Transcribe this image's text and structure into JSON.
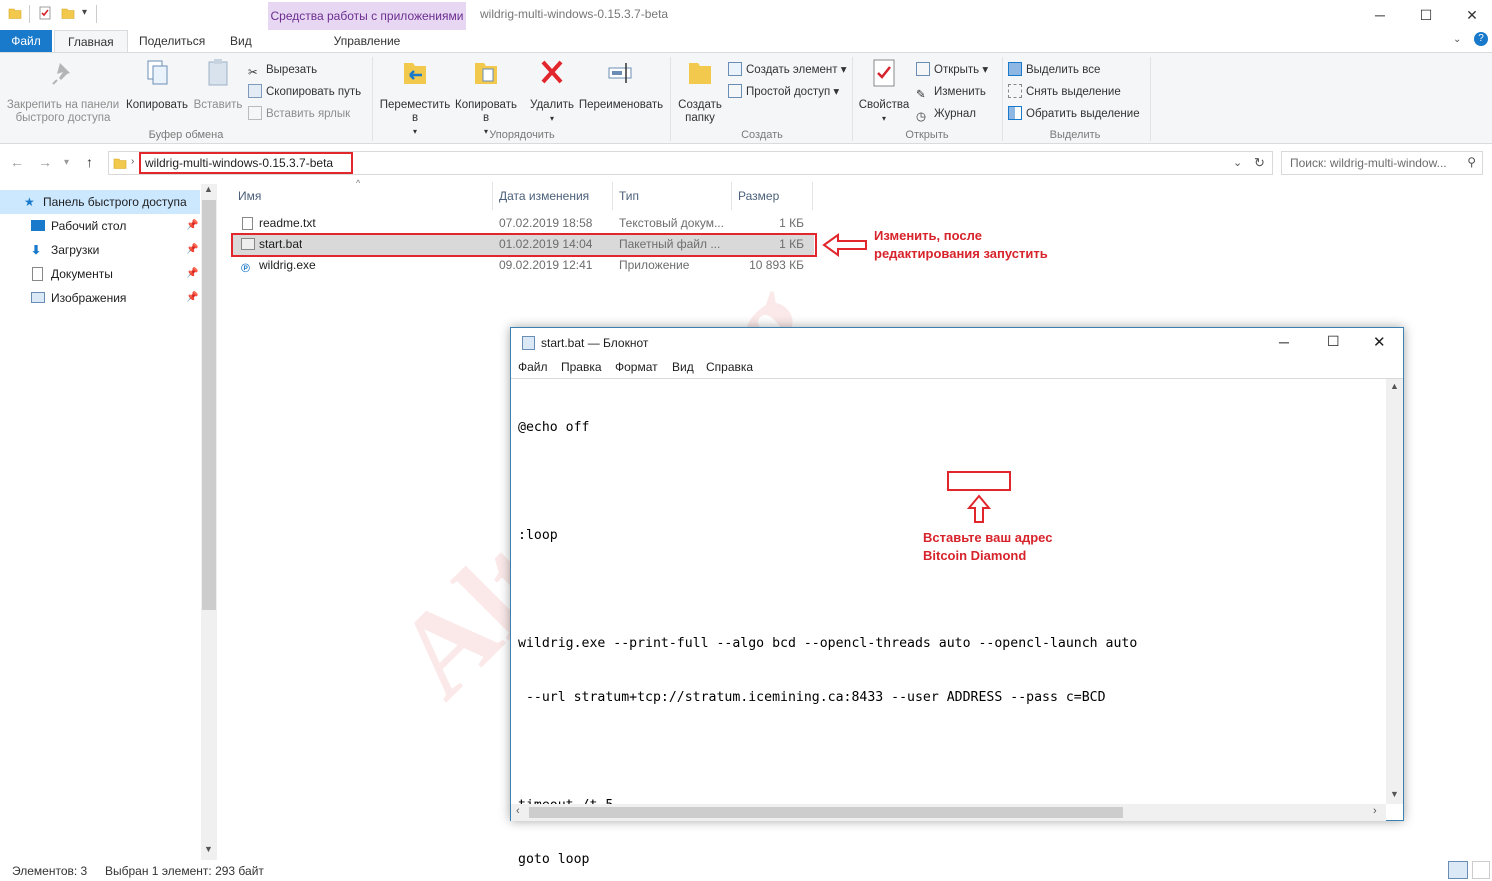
{
  "window": {
    "title": "wildrig-multi-windows-0.15.3.7-beta",
    "context_group": "Средства работы с приложениями"
  },
  "tabs": {
    "file": "Файл",
    "home": "Главная",
    "share": "Поделиться",
    "view": "Вид",
    "manage": "Управление"
  },
  "ribbon": {
    "clipboard": {
      "pin": "Закрепить на панели быстрого доступа",
      "copy": "Копировать",
      "paste": "Вставить",
      "cut": "Вырезать",
      "copy_path": "Скопировать путь",
      "paste_shortcut": "Вставить ярлык",
      "label": "Буфер обмена"
    },
    "organize": {
      "move_to": "Переместить в",
      "copy_to": "Копировать в",
      "delete": "Удалить",
      "rename": "Переименовать",
      "label": "Упорядочить"
    },
    "new": {
      "new_folder": "Создать папку",
      "new_item": "Создать элемент",
      "easy_access": "Простой доступ",
      "label": "Создать"
    },
    "open": {
      "properties": "Свойства",
      "open": "Открыть",
      "edit": "Изменить",
      "history": "Журнал",
      "label": "Открыть"
    },
    "select": {
      "select_all": "Выделить все",
      "select_none": "Снять выделение",
      "invert": "Обратить выделение",
      "label": "Выделить"
    }
  },
  "address": {
    "path": "wildrig-multi-windows-0.15.3.7-beta",
    "search_placeholder": "Поиск: wildrig-multi-window..."
  },
  "nav": {
    "items": [
      {
        "label": "Панель быстрого доступа",
        "icon": "star-icon"
      },
      {
        "label": "Рабочий стол",
        "icon": "desktop-icon"
      },
      {
        "label": "Загрузки",
        "icon": "download-icon"
      },
      {
        "label": "Документы",
        "icon": "documents-icon"
      },
      {
        "label": "Изображения",
        "icon": "pictures-icon"
      }
    ]
  },
  "columns": {
    "name": "Имя",
    "date": "Дата изменения",
    "type": "Тип",
    "size": "Размер"
  },
  "files": [
    {
      "name": "readme.txt",
      "date": "07.02.2019 18:58",
      "type": "Текстовый докум...",
      "size": "1 КБ"
    },
    {
      "name": "start.bat",
      "date": "01.02.2019 14:04",
      "type": "Пакетный файл ...",
      "size": "1 КБ"
    },
    {
      "name": "wildrig.exe",
      "date": "09.02.2019 12:41",
      "type": "Приложение",
      "size": "10 893 КБ"
    }
  ],
  "annotations": {
    "file_note_line1": "Изменить, после",
    "file_note_line2": "редактирования запустить",
    "address_note_line1": "Вставьте ваш адрес",
    "address_note_line2": "Bitcoin Diamond"
  },
  "notepad": {
    "title": "start.bat — Блокнот",
    "menu": [
      "Файл",
      "Правка",
      "Формат",
      "Вид",
      "Справка"
    ],
    "lines": [
      "@echo off",
      "",
      ":loop",
      "",
      "wildrig.exe --print-full --algo bcd --opencl-threads auto --opencl-launch auto",
      " --url stratum+tcp://stratum.icemining.ca:8433 --user ADDRESS --pass c=BCD",
      "",
      "timeout /t 5",
      "goto loop"
    ]
  },
  "status": {
    "count": "Элементов: 3",
    "selected": "Выбран 1 элемент: 293 байт"
  },
  "watermark": "Altcoinlog",
  "colors": {
    "accent": "#1979ca",
    "highlight": "#e1262c",
    "selection": "#d9d9d9"
  }
}
